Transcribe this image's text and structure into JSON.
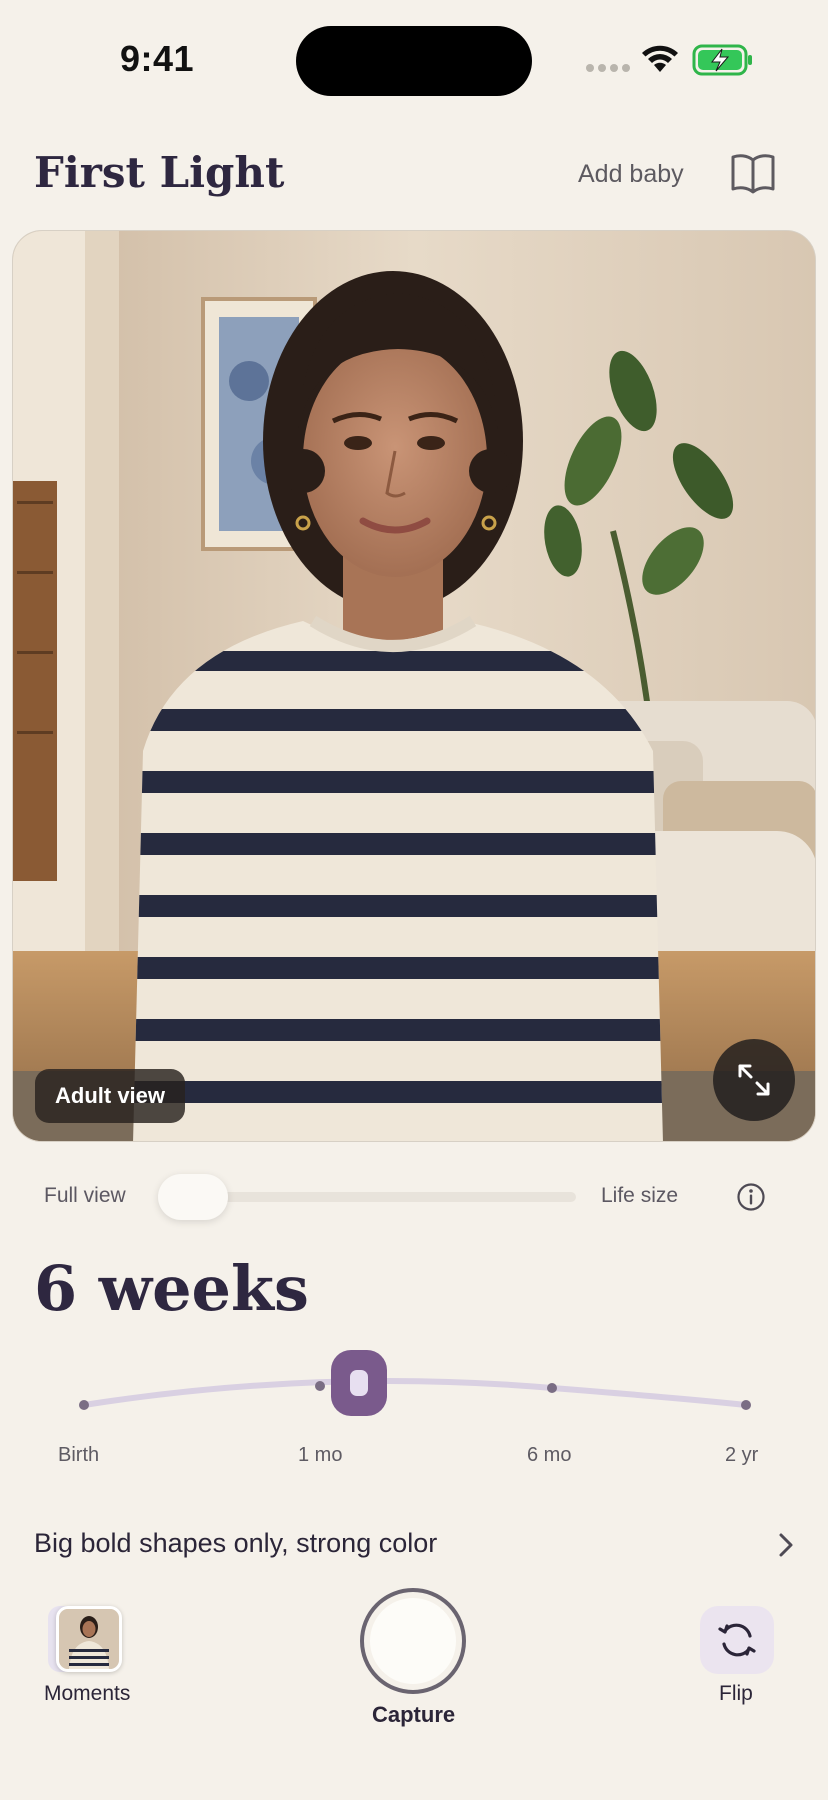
{
  "status_bar": {
    "time": "9:41"
  },
  "header": {
    "title": "First Light",
    "add_baby_label": "Add baby",
    "book_icon": "book-icon"
  },
  "viewport": {
    "badge": "Adult view",
    "expand_icon": "expand-icon"
  },
  "zoom": {
    "left_label": "Full view",
    "right_label": "Life size",
    "level": 0,
    "info_icon": "info-icon"
  },
  "age": {
    "label": "6 weeks",
    "timeline": {
      "labels": [
        "Birth",
        "1 mo",
        "6 mo",
        "2 yr"
      ],
      "selected_index": 1
    }
  },
  "tip": {
    "text": "Big bold shapes only, strong color",
    "chevron_icon": "chevron-right-icon"
  },
  "bottom_bar": {
    "moments_label": "Moments",
    "capture_label": "Capture",
    "flip_label": "Flip",
    "flip_icon": "flip-camera-icon"
  },
  "colors": {
    "background": "#f5f1ea",
    "accent": "#7a5a8c",
    "track": "#d9d0e2",
    "title": "#2e2740"
  }
}
